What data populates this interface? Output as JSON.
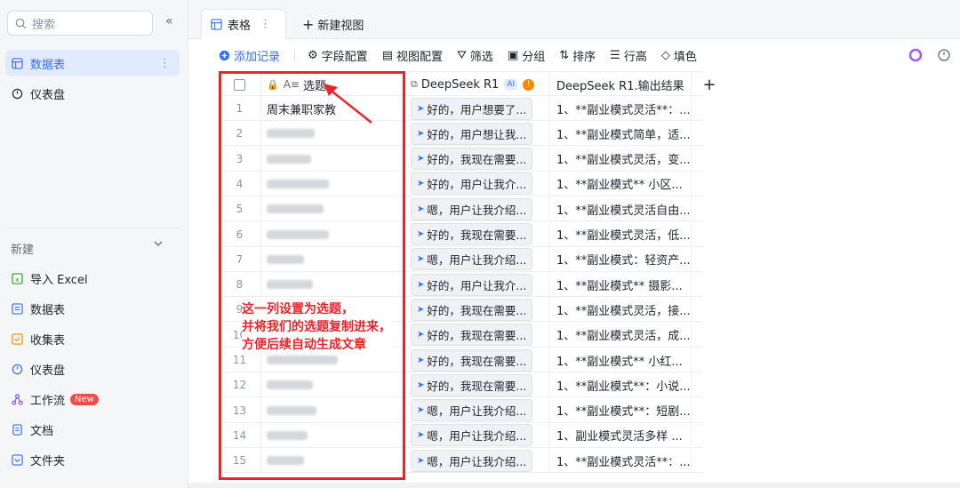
{
  "sidebar": {
    "search_placeholder": "搜索",
    "top_items": [
      {
        "label": "数据表",
        "icon": "table-icon",
        "active": true
      },
      {
        "label": "仪表盘",
        "icon": "dashboard-icon",
        "active": false
      }
    ],
    "new_section": "新建",
    "new_items": [
      {
        "label": "导入 Excel",
        "icon": "excel-icon"
      },
      {
        "label": "数据表",
        "icon": "table-icon"
      },
      {
        "label": "收集表",
        "icon": "form-icon"
      },
      {
        "label": "仪表盘",
        "icon": "dashboard-icon"
      },
      {
        "label": "工作流",
        "icon": "workflow-icon",
        "badge": "New"
      },
      {
        "label": "文档",
        "icon": "doc-icon"
      },
      {
        "label": "文件夹",
        "icon": "folder-icon"
      }
    ]
  },
  "tabs": {
    "active": "表格",
    "add": "新建视图"
  },
  "toolbar": {
    "add_record": "添加记录",
    "field_config": "字段配置",
    "view_config": "视图配置",
    "filter": "筛选",
    "group": "分组",
    "sort": "排序",
    "row_height": "行高",
    "fill": "填色"
  },
  "table": {
    "headers": {
      "title": "选题",
      "deepseek": "DeepSeek R1",
      "ai_tag": "AI",
      "warn": "!",
      "output": "DeepSeek R1.输出结果",
      "add": "+"
    },
    "rows": [
      {
        "n": "1",
        "title": "周末兼职家教",
        "blur_w": 0,
        "ds": "好的，用户想要了...",
        "out": "1、**副业模式灵活**：..."
      },
      {
        "n": "2",
        "title": "",
        "blur_w": 54,
        "ds": "好的，用户想让我...",
        "out": "1、**副业模式简单，适..."
      },
      {
        "n": "3",
        "title": "",
        "blur_w": 50,
        "ds": "好的，我现在需要...",
        "out": "1、**副业模式灵活，变..."
      },
      {
        "n": "4",
        "title": "",
        "blur_w": 70,
        "ds": "好的，用户让我介...",
        "out": "1、**副业模式** 小区..."
      },
      {
        "n": "5",
        "title": "",
        "blur_w": 64,
        "ds": "嗯，用户让我介绍...",
        "out": "1、**副业模式灵活自由..."
      },
      {
        "n": "6",
        "title": "",
        "blur_w": 70,
        "ds": "好的，我现在需要...",
        "out": "1、**副业模式灵活，低..."
      },
      {
        "n": "7",
        "title": "",
        "blur_w": 42,
        "ds": "嗯，用户让我介绍...",
        "out": "1、**副业模式：轻资产..."
      },
      {
        "n": "8",
        "title": "",
        "blur_w": 52,
        "ds": "好的，用户让我介...",
        "out": "1、**副业模式** 摄影..."
      },
      {
        "n": "9",
        "title": "",
        "blur_w": 0,
        "ds": "好的，我现在需要...",
        "out": "1、**副业模式灵活，接..."
      },
      {
        "n": "10",
        "title": "",
        "blur_w": 0,
        "ds": "好的，我现在需要...",
        "out": "1、**副业模式灵活，成..."
      },
      {
        "n": "11",
        "title": "",
        "blur_w": 80,
        "ds": "好的，我现在需要...",
        "out": "1、**副业模式** 小红..."
      },
      {
        "n": "12",
        "title": "",
        "blur_w": 52,
        "ds": "好的，我现在需要...",
        "out": "1、**副业模式**：小说..."
      },
      {
        "n": "13",
        "title": "",
        "blur_w": 56,
        "ds": "嗯，用户让我介绍...",
        "out": "1、**副业模式**：短剧..."
      },
      {
        "n": "14",
        "title": "",
        "blur_w": 46,
        "ds": "嗯，用户让我介绍...",
        "out": "1、副业模式灵活多样 ..."
      },
      {
        "n": "15",
        "title": "",
        "blur_w": 42,
        "ds": "嗯，用户让我介绍...",
        "out": "1、**副业模式灵活**：..."
      }
    ]
  },
  "annotation": {
    "line1": "这一列设置为选题，",
    "line2": "并将我们的选题复制进来，",
    "line3": "方便后续自动生成文章",
    "color": "#e8252a"
  },
  "colors": {
    "accent": "#3370ff",
    "sidebar_bg": "#f5f6f7"
  }
}
